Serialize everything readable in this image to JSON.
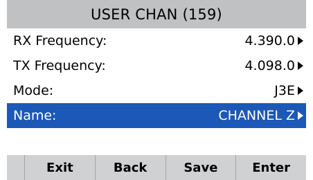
{
  "title": "USER CHAN (159)",
  "menu": {
    "rows": [
      {
        "label": "RX Frequency:",
        "value": "4.390.0"
      },
      {
        "label": "TX Frequency:",
        "value": "4.098.0"
      },
      {
        "label": "Mode:",
        "value": "J3E"
      },
      {
        "label": "Name:",
        "value": "CHANNEL Z"
      }
    ],
    "selected_index": 3,
    "arrow_icon": "right-triangle-icon"
  },
  "softkeys": [
    "Exit",
    "Back",
    "Save",
    "Enter"
  ],
  "colors": {
    "title_bar": "#bfc1c3",
    "selection": "#1b58b7",
    "softkey_bar": "#cfd1d3"
  }
}
